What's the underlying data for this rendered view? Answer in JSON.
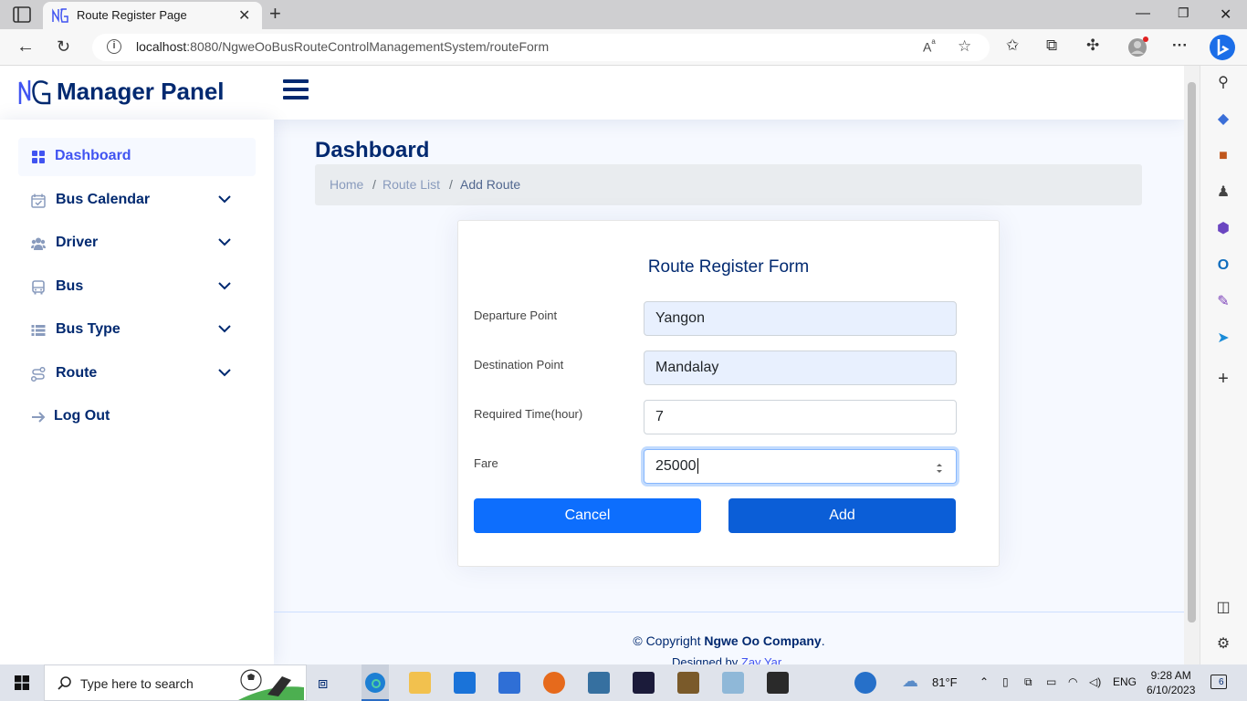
{
  "browser": {
    "tab_title": "Route Register Page",
    "url_host": "localhost",
    "url_path": ":8080/NgweOoBusRouteControlManagementSystem/routeForm"
  },
  "header": {
    "logo_text": "Manager Panel"
  },
  "sidebar": {
    "items": [
      {
        "label": "Dashboard",
        "icon": "grid-icon"
      },
      {
        "label": "Bus Calendar",
        "icon": "calendar-check-icon"
      },
      {
        "label": "Driver",
        "icon": "people-icon"
      },
      {
        "label": "Bus",
        "icon": "bus-icon"
      },
      {
        "label": "Bus Type",
        "icon": "list-icon"
      },
      {
        "label": "Route",
        "icon": "route-icon"
      },
      {
        "label": "Log Out",
        "icon": "arrow-right-icon"
      }
    ]
  },
  "main": {
    "page_title": "Dashboard",
    "breadcrumb": [
      "Home",
      "Route List",
      "Add Route"
    ]
  },
  "form": {
    "title": "Route Register Form",
    "fields": [
      {
        "label": "Departure Point",
        "value": "Yangon"
      },
      {
        "label": "Destination Point",
        "value": "Mandalay"
      },
      {
        "label": "Required Time(hour)",
        "value": "7"
      },
      {
        "label": "Fare",
        "value": "25000"
      }
    ],
    "cancel_label": "Cancel",
    "add_label": "Add"
  },
  "footer": {
    "copyright_prefix": "© Copyright ",
    "company": "Ngwe Oo Company",
    "copyright_suffix": ".",
    "designed_by_prefix": "Designed by ",
    "designer": "Zay Yar"
  },
  "taskbar": {
    "search_placeholder": "Type here to search",
    "weather": "81°F",
    "language": "ENG",
    "time": "9:28 AM",
    "date": "6/10/2023",
    "notifications": "6"
  },
  "colors": {
    "brand": "#012970",
    "accent": "#4154f1",
    "primary_button": "#0d6efd"
  }
}
